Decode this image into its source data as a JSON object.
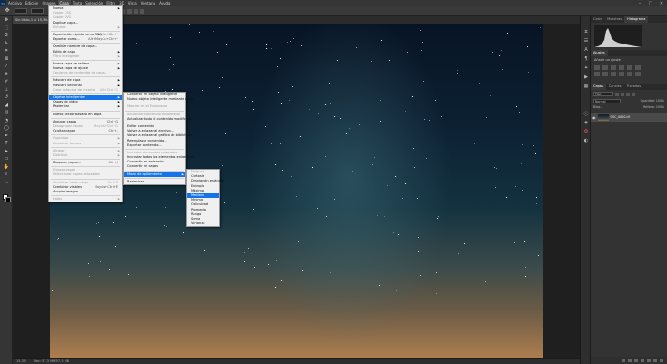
{
  "menubar": {
    "items": [
      "Archivo",
      "Edición",
      "Imagen",
      "Capa",
      "Texto",
      "Selección",
      "Filtro",
      "3D",
      "Vista",
      "Ventana",
      "Ayuda"
    ],
    "active_index": 3
  },
  "document": {
    "tab_title": "Sin título-1 al 15,3% (RGB/8#)"
  },
  "status": {
    "zoom": "15,3%",
    "doc_info": "Doc: 57,3 MB/57,3 MB"
  },
  "layer_menu": {
    "items": [
      {
        "label": "Nueva",
        "arrow": true
      },
      {
        "label": "Copiar CSS",
        "disabled": true
      },
      {
        "label": "Copiar SVG",
        "disabled": true
      },
      {
        "label": "Duplicar capa..."
      },
      {
        "label": "Eliminar",
        "arrow": true,
        "disabled": true
      },
      {
        "sep": true
      },
      {
        "label": "Exportación rápida como PNG",
        "shortcut": "Mayús+Ctrl+'"
      },
      {
        "label": "Exportar como...",
        "shortcut": "Alt+Mayús+Ctrl+'"
      },
      {
        "sep": true
      },
      {
        "label": "Cambiar nombre de capa..."
      },
      {
        "label": "Estilo de capa",
        "arrow": true
      },
      {
        "label": "Filtro inteligente",
        "arrow": true,
        "disabled": true
      },
      {
        "sep": true
      },
      {
        "label": "Nueva capa de relleno",
        "arrow": true
      },
      {
        "label": "Nueva capa de ajuste",
        "arrow": true
      },
      {
        "label": "Opciones de contenido de capa...",
        "disabled": true
      },
      {
        "sep": true
      },
      {
        "label": "Máscara de capa",
        "arrow": true
      },
      {
        "label": "Máscara vectorial",
        "arrow": true
      },
      {
        "label": "Crear máscara de recorte",
        "shortcut": "Alt+Ctrl+G",
        "disabled": true
      },
      {
        "sep": true
      },
      {
        "label": "Objetos inteligentes",
        "arrow": true,
        "highlight": true
      },
      {
        "label": "Capas de vídeo",
        "arrow": true
      },
      {
        "label": "Rasterizar",
        "arrow": true
      },
      {
        "sep": true
      },
      {
        "label": "Nuevo sector basado en capa"
      },
      {
        "sep": true
      },
      {
        "label": "Agrupar capas",
        "shortcut": "Ctrl+G"
      },
      {
        "label": "Desagrupar capas",
        "shortcut": "Mayús+Ctrl+G",
        "disabled": true
      },
      {
        "label": "Ocultar capas",
        "shortcut": "Ctrl+,"
      },
      {
        "sep": true
      },
      {
        "label": "Organizar",
        "arrow": true,
        "disabled": true
      },
      {
        "label": "Combinar formas",
        "arrow": true,
        "disabled": true
      },
      {
        "sep": true
      },
      {
        "label": "Alinear",
        "arrow": true,
        "disabled": true
      },
      {
        "label": "Distribuir",
        "arrow": true,
        "disabled": true
      },
      {
        "sep": true
      },
      {
        "label": "Bloquear capas...",
        "shortcut": "Ctrl+/"
      },
      {
        "sep": true
      },
      {
        "label": "Enlazar capas",
        "disabled": true
      },
      {
        "label": "Seleccionar capas enlazadas",
        "disabled": true
      },
      {
        "sep": true
      },
      {
        "label": "Combinar hacia abajo",
        "shortcut": "Ctrl+E",
        "disabled": true
      },
      {
        "label": "Combinar visibles",
        "shortcut": "Mayús+Ctrl+E"
      },
      {
        "label": "Acoplar imagen"
      },
      {
        "sep": true
      },
      {
        "label": "Halos",
        "arrow": true,
        "disabled": true
      }
    ]
  },
  "smart_objects_menu": {
    "items": [
      {
        "label": "Convertir en objeto inteligente"
      },
      {
        "label": "Nuevo objeto inteligente mediante copia"
      },
      {
        "sep": true
      },
      {
        "label": "Mostrar en el Explorador",
        "disabled": true
      },
      {
        "sep": true
      },
      {
        "label": "Actualizar contenido modificado",
        "disabled": true
      },
      {
        "label": "Actualizar todo el contenido modificado"
      },
      {
        "sep": true
      },
      {
        "label": "Editar contenido"
      },
      {
        "label": "Volver a enlazar al archivo..."
      },
      {
        "label": "Volver a enlazar al gráfico de biblioteca..."
      },
      {
        "label": "Reemplazar contenido..."
      },
      {
        "label": "Exportar contenido..."
      },
      {
        "sep": true
      },
      {
        "label": "Incrustar elementos enlazados",
        "disabled": true
      },
      {
        "label": "Incrustar todos los elementos enlazados"
      },
      {
        "label": "Convertir en enlazado..."
      },
      {
        "label": "Convertir en capas"
      },
      {
        "sep": true
      },
      {
        "label": "Modo de apilamiento",
        "arrow": true,
        "highlight": true
      },
      {
        "sep": true
      },
      {
        "label": "Rasterizar"
      }
    ]
  },
  "stack_mode_menu": {
    "items": [
      {
        "label": "Ninguno",
        "disabled": true
      },
      {
        "label": "Curtosis"
      },
      {
        "label": "Desviación estándar"
      },
      {
        "label": "Entropía"
      },
      {
        "label": "Máximo"
      },
      {
        "label": "Mediana",
        "highlight": true
      },
      {
        "label": "Mínimo"
      },
      {
        "label": "Oblicuidad"
      },
      {
        "label": "Promedio"
      },
      {
        "label": "Rango"
      },
      {
        "label": "Suma"
      },
      {
        "label": "Varianza"
      }
    ]
  },
  "panels": {
    "top_tabs": [
      "Color",
      "Muestras",
      "Histograma"
    ],
    "top_active": 2,
    "adjust_tab": "Ajustes",
    "adjust_title": "Añadir un ajuste",
    "layer_tabs": [
      "Capas",
      "Canales",
      "Trazados"
    ],
    "layer_active": 0,
    "filter_label": "Tipo",
    "blend_mode": "Normal",
    "opacity": "Opacidad: 100%",
    "lock": "Bloq.:",
    "fill": "Relleno: 100%",
    "layer_name": "DSC_0020.tif"
  }
}
